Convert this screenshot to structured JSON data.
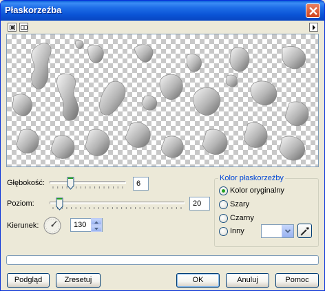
{
  "window": {
    "title": "Płaskorzeźba"
  },
  "icons": {
    "close": "close-icon",
    "view_single": "single-view-icon",
    "view_split": "split-view-icon",
    "menu_arrow": "right-arrow-icon",
    "angle_dial": "angle-dial-icon",
    "dropdown": "chevron-down-icon",
    "eyedropper": "eyedropper-icon"
  },
  "controls": {
    "depth": {
      "label": "Głębokość:",
      "value": "6",
      "fraction": 0.25
    },
    "level": {
      "label": "Poziom:",
      "value": "20",
      "fraction": 0.05
    },
    "direction": {
      "label": "Kierunek:",
      "value": "130"
    }
  },
  "color_group": {
    "title": "Kolor płaskorzeźby",
    "options": [
      "Kolor oryginalny",
      "Szary",
      "Czarny",
      "Inny"
    ],
    "selected_index": 0
  },
  "buttons": {
    "preview": "Podgląd",
    "reset": "Zresetuj",
    "ok": "OK",
    "cancel": "Anuluj",
    "help": "Pomoc"
  },
  "colors": {
    "title_bar": "#0a54d6",
    "dialog_bg": "#ece9d8",
    "accent": "#0046d5",
    "radio_selected": "#21a121"
  }
}
